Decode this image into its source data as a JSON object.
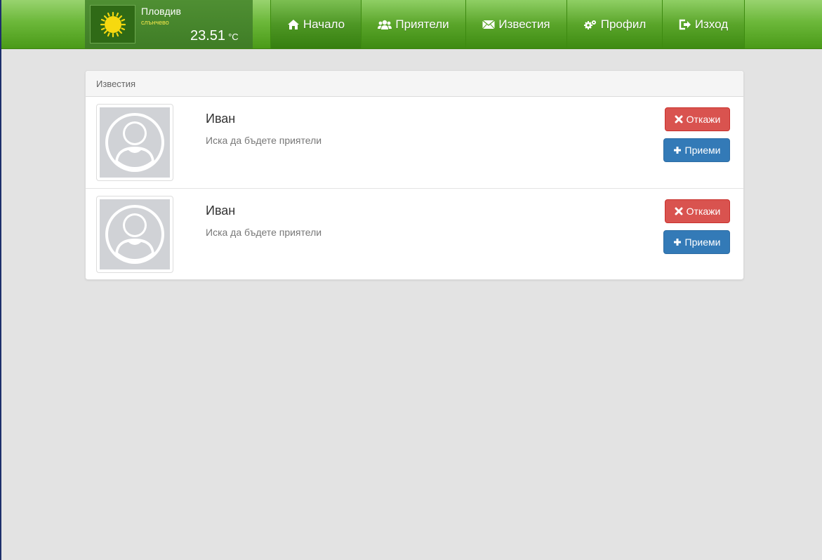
{
  "weather": {
    "city": "Пловдив",
    "condition": "слънчево",
    "temperature": "23.51",
    "unit": "°C",
    "icon": "sun-icon"
  },
  "nav": [
    {
      "label": "Начало",
      "icon": "home-icon"
    },
    {
      "label": "Приятели",
      "icon": "users-icon"
    },
    {
      "label": "Известия",
      "icon": "envelope-icon"
    },
    {
      "label": "Профил",
      "icon": "gears-icon"
    },
    {
      "label": "Изход",
      "icon": "logout-icon"
    }
  ],
  "panel": {
    "title": "Известия",
    "notifications": [
      {
        "name": "Иван",
        "message": "Иска да бъдете приятели",
        "reject_label": "Откажи",
        "accept_label": "Приеми"
      },
      {
        "name": "Иван",
        "message": "Иска да бъдете приятели",
        "reject_label": "Откажи",
        "accept_label": "Приеми"
      }
    ]
  },
  "colors": {
    "topbar": "#6cb83a",
    "reject": "#d9534f",
    "accept": "#337ab7",
    "condition_text": "#f2e64b"
  }
}
